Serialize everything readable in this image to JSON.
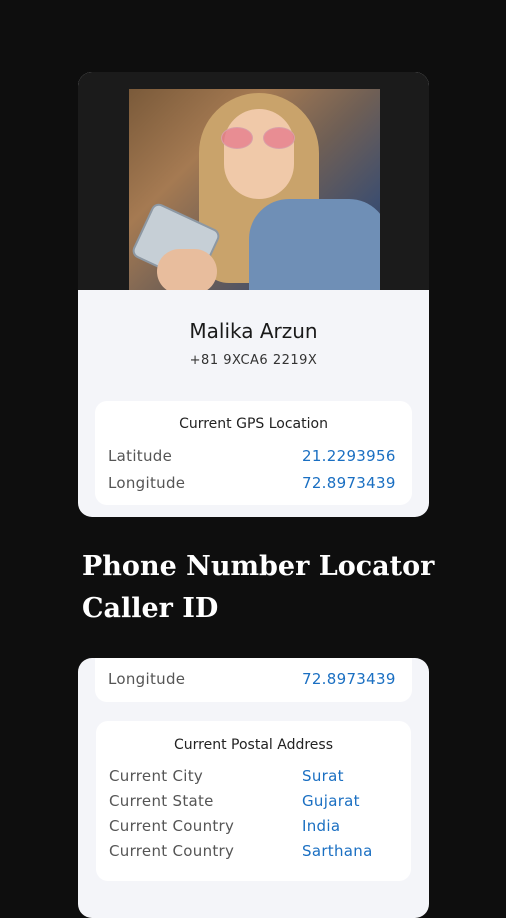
{
  "profile": {
    "name": "Malika Arzun",
    "phone": "+81 9XCA6 2219X"
  },
  "gps": {
    "title": "Current GPS Location",
    "latitude_label": "Latitude",
    "latitude_value": "21.2293956",
    "longitude_label": "Longitude",
    "longitude_value": "72.8973439"
  },
  "headline": {
    "line1": "Phone Number Locator",
    "line2": "Caller ID"
  },
  "partial": {
    "longitude_label": "Longitude",
    "longitude_value": "72.8973439"
  },
  "postal": {
    "title": "Current Postal Address",
    "rows": [
      {
        "label": "Current City",
        "value": "Surat"
      },
      {
        "label": "Current State",
        "value": "Gujarat"
      },
      {
        "label": "Current Country",
        "value": "India"
      },
      {
        "label": "Current Country",
        "value": "Sarthana"
      }
    ]
  },
  "colors": {
    "background": "#0e0e0e",
    "card": "#f4f5f9",
    "accent_value": "#1a6fc2"
  }
}
